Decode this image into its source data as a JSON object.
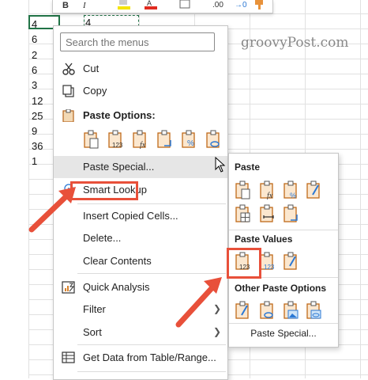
{
  "sheet": {
    "cells": [
      "4",
      "6",
      "2",
      "6",
      "3",
      "12",
      "25",
      "9",
      "36",
      "1"
    ],
    "marquee_partial": "4"
  },
  "mini_toolbar": {
    "bold": "B",
    "italic": "I",
    "dec_1": ".00",
    "dec_2": "→0"
  },
  "watermark": "groovyPost.com",
  "context_menu": {
    "search_placeholder": "Search the menus",
    "cut": "Cut",
    "copy": "Copy",
    "paste_options_label": "Paste Options:",
    "paste_special": "Paste Special...",
    "smart_lookup": "Smart Lookup",
    "insert_copied_cells": "Insert Copied Cells...",
    "delete": "Delete...",
    "clear_contents": "Clear Contents",
    "quick_analysis": "Quick Analysis",
    "filter": "Filter",
    "sort": "Sort",
    "get_data": "Get Data from Table/Range..."
  },
  "submenu": {
    "paste_header": "Paste",
    "paste_values_header": "Paste Values",
    "other_header": "Other Paste Options",
    "footer": "Paste Special..."
  },
  "colors": {
    "accent_green": "#217346",
    "highlight_red": "#e8503a",
    "icon_orange": "#d9822b",
    "icon_blue": "#2b78d4"
  }
}
